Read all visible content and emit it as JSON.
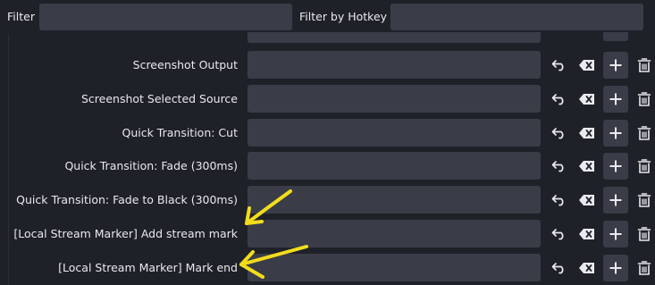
{
  "filter": {
    "label": "Filter",
    "value": "",
    "hotkey_label": "Filter by Hotkey",
    "hotkey_value": ""
  },
  "rows": [
    {
      "label": "Screenshot Output",
      "hotkey": ""
    },
    {
      "label": "Screenshot Selected Source",
      "hotkey": ""
    },
    {
      "label": "Quick Transition: Cut",
      "hotkey": ""
    },
    {
      "label": "Quick Transition: Fade (300ms)",
      "hotkey": ""
    },
    {
      "label": "Quick Transition: Fade to Black (300ms)",
      "hotkey": ""
    },
    {
      "label": "[Local Stream Marker] Add stream mark",
      "hotkey": ""
    },
    {
      "label": "[Local Stream Marker] Mark end",
      "hotkey": ""
    }
  ],
  "icons": {
    "revert": "undo-arrow-icon",
    "clear": "backspace-clear-icon",
    "add": "plus-icon",
    "remove": "trash-icon"
  },
  "colors": {
    "background": "#1f2129",
    "input": "#3a3d48",
    "text": "#e9e9ee",
    "annotation_arrow": "#f2dd1b"
  }
}
